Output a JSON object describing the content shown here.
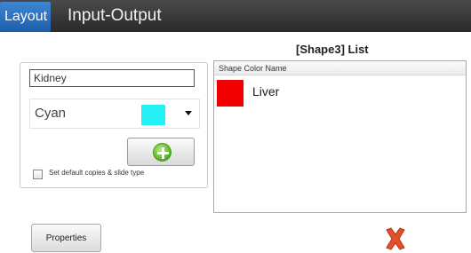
{
  "tabs": [
    {
      "label": "Layout",
      "active": true
    },
    {
      "label": "Input-Output",
      "active": false
    }
  ],
  "shape_form": {
    "name_value": "Kidney",
    "color": {
      "name": "Cyan",
      "hex": "#22f0f5"
    },
    "add_icon": "plus-circle-icon",
    "default_checkbox_label": "Set default copies & slide type",
    "default_checkbox_checked": false
  },
  "list": {
    "title": "[Shape3] List",
    "column_header": "Shape Color Name",
    "rows": [
      {
        "label": "Liver",
        "color": "#f20000"
      }
    ]
  },
  "footer": {
    "properties_label": "Properties",
    "close_icon": "red-x-icon"
  },
  "colors": {
    "tab_active": "#2a6fc0",
    "topbar": "#333333",
    "add_green": "#5fb82a",
    "delete_red": "#e2502a"
  }
}
